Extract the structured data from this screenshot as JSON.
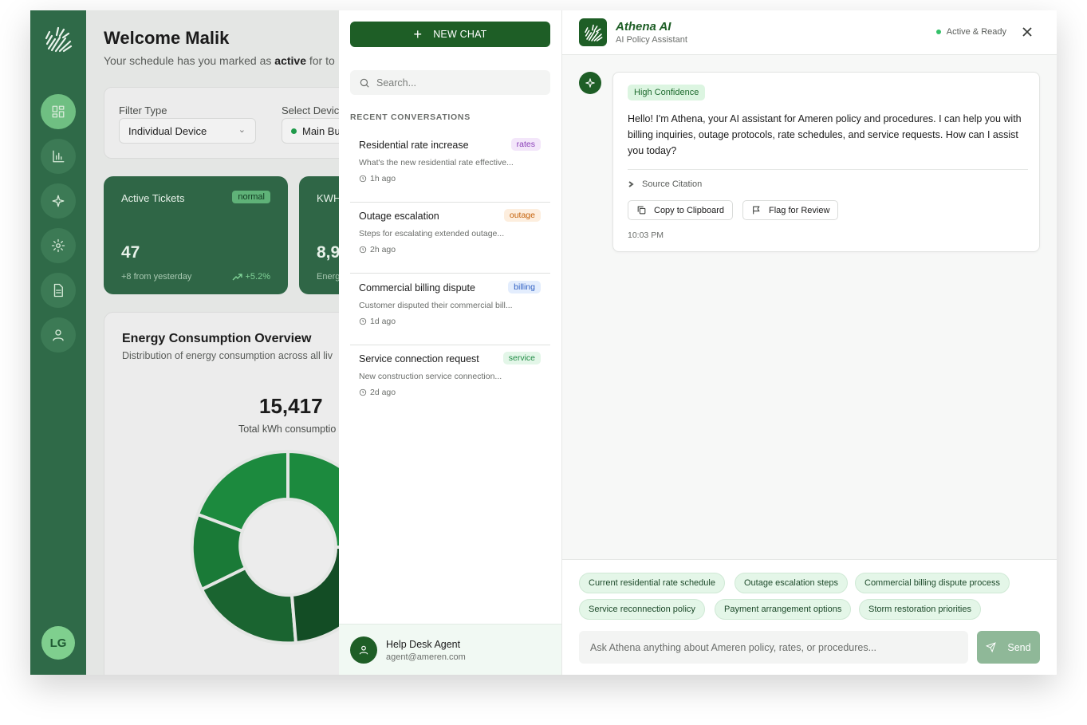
{
  "dashboard": {
    "welcome": "Welcome Malik",
    "subtitle_prefix": "Your schedule has you marked as ",
    "subtitle_bold": "active",
    "subtitle_suffix": " for to",
    "filter_type_label": "Filter Type",
    "filter_type_value": "Individual Device",
    "select_device_label": "Select Devic",
    "select_device_value": "Main Bu",
    "active_tickets": {
      "label": "Active Tickets",
      "badge": "normal",
      "value": "47",
      "meta": "+8 from yesterday",
      "trend": "+5.2%"
    },
    "kwh_card": {
      "label": "KWH",
      "value": "8,9",
      "meta": "Energ"
    },
    "energy": {
      "title": "Energy Consumption Overview",
      "subtitle": "Distribution of energy consumption across all liv",
      "total": "15,417",
      "total_label": "Total kWh consumptio"
    },
    "user_initials": "LG"
  },
  "sidebar": {
    "items": [
      "dashboard-icon",
      "chart-icon",
      "sparkle-icon",
      "settings-icon",
      "document-icon",
      "user-icon"
    ]
  },
  "conversations": {
    "new_chat_label": "NEW CHAT",
    "search_placeholder": "Search...",
    "recent_heading": "RECENT CONVERSATIONS",
    "items": [
      {
        "title": "Residential rate increase",
        "tag": "rates",
        "preview": "What's the new residential rate effective...",
        "time": "1h ago"
      },
      {
        "title": "Outage escalation",
        "tag": "outage",
        "preview": "Steps for escalating extended outage...",
        "time": "2h ago"
      },
      {
        "title": "Commercial billing dispute",
        "tag": "billing",
        "preview": "Customer disputed their commercial bill...",
        "time": "1d ago"
      },
      {
        "title": "Service connection request",
        "tag": "service",
        "preview": "New construction service connection...",
        "time": "2d ago"
      }
    ],
    "agent": {
      "name": "Help Desk Agent",
      "email": "agent@ameren.com"
    }
  },
  "chat": {
    "assistant_name": "Athena AI",
    "assistant_subtitle": "AI Policy Assistant",
    "status": "Active & Ready",
    "message": {
      "confidence": "High Confidence",
      "text": "Hello! I'm Athena, your AI assistant for Ameren policy and procedures. I can help you with billing inquiries, outage protocols, rate schedules, and service requests. How can I assist you today?",
      "citation_label": "Source Citation",
      "copy_label": "Copy to Clipboard",
      "flag_label": "Flag for Review",
      "time": "10:03 PM"
    },
    "suggestions": [
      "Current residential rate schedule",
      "Outage escalation steps",
      "Commercial billing dispute process",
      "Service reconnection policy",
      "Payment arrangement options",
      "Storm restoration priorities"
    ],
    "input_placeholder": "Ask Athena anything about Ameren policy, rates, or procedures...",
    "send_label": "Send"
  },
  "colors": {
    "brand_green": "#1e5e26",
    "sidebar_green": "#2f6a48",
    "status_green": "#35c16a"
  }
}
